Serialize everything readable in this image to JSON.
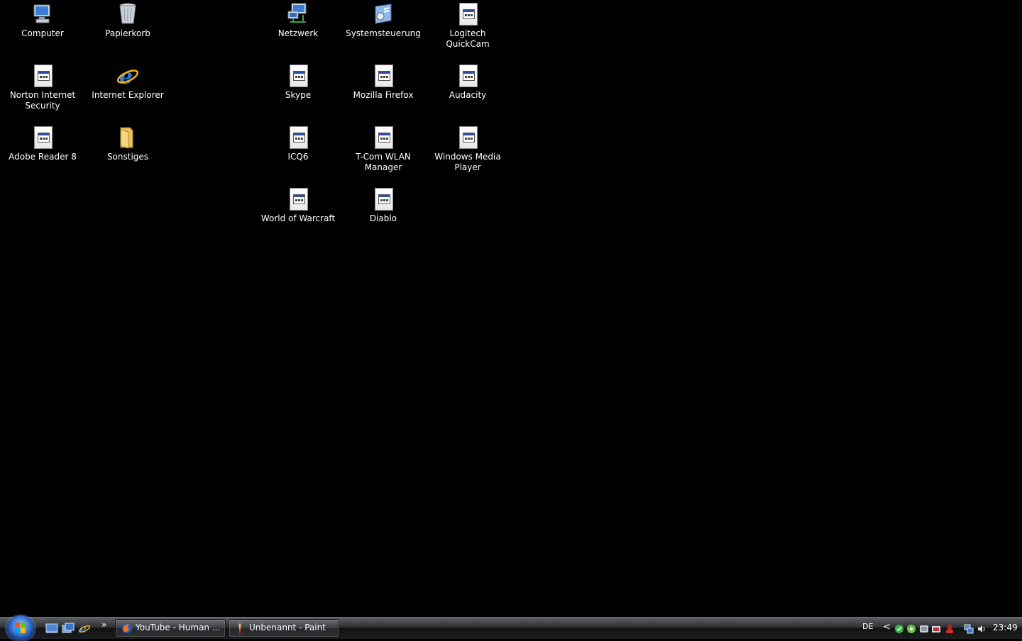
{
  "desktop": {
    "icons": [
      {
        "label": "Computer",
        "icon": "computer-icon"
      },
      {
        "label": "Papierkorb",
        "icon": "recycle-bin-icon"
      },
      {
        "label": "Netzwerk",
        "icon": "network-icon"
      },
      {
        "label": "Systemsteuerung",
        "icon": "control-panel-icon"
      },
      {
        "label": "Logitech QuickCam",
        "icon": "shortcut-file-icon"
      },
      {
        "label": "Norton Internet Security",
        "icon": "shortcut-file-icon"
      },
      {
        "label": "Internet Explorer",
        "icon": "internet-explorer-icon"
      },
      {
        "label": "Skype",
        "icon": "shortcut-file-icon"
      },
      {
        "label": "Mozilla Firefox",
        "icon": "shortcut-file-icon"
      },
      {
        "label": "Audacity",
        "icon": "shortcut-file-icon"
      },
      {
        "label": "Adobe Reader 8",
        "icon": "shortcut-file-icon"
      },
      {
        "label": "Sonstiges",
        "icon": "folder-icon"
      },
      {
        "label": "ICQ6",
        "icon": "shortcut-file-icon"
      },
      {
        "label": "T-Com WLAN Manager",
        "icon": "shortcut-file-icon"
      },
      {
        "label": "Windows Media Player",
        "icon": "shortcut-file-icon"
      },
      {
        "label": "World of Warcraft",
        "icon": "shortcut-file-icon"
      },
      {
        "label": "Diablo",
        "icon": "shortcut-file-icon"
      }
    ]
  },
  "taskbar": {
    "start_icon": "windows-start-orb-icon",
    "quick_launch": [
      "show-desktop-icon",
      "switch-windows-icon",
      "internet-explorer-icon"
    ],
    "quick_launch_more": "»",
    "tasks": [
      {
        "label": "YouTube - Human ...",
        "icon": "firefox-icon"
      },
      {
        "label": "Unbenannt - Paint",
        "icon": "paint-icon"
      }
    ],
    "language": "DE",
    "tray_expand": "<",
    "clock": "23:49"
  },
  "colors": {
    "desktop_background": "#000000",
    "taskbar": "#2e3033"
  }
}
